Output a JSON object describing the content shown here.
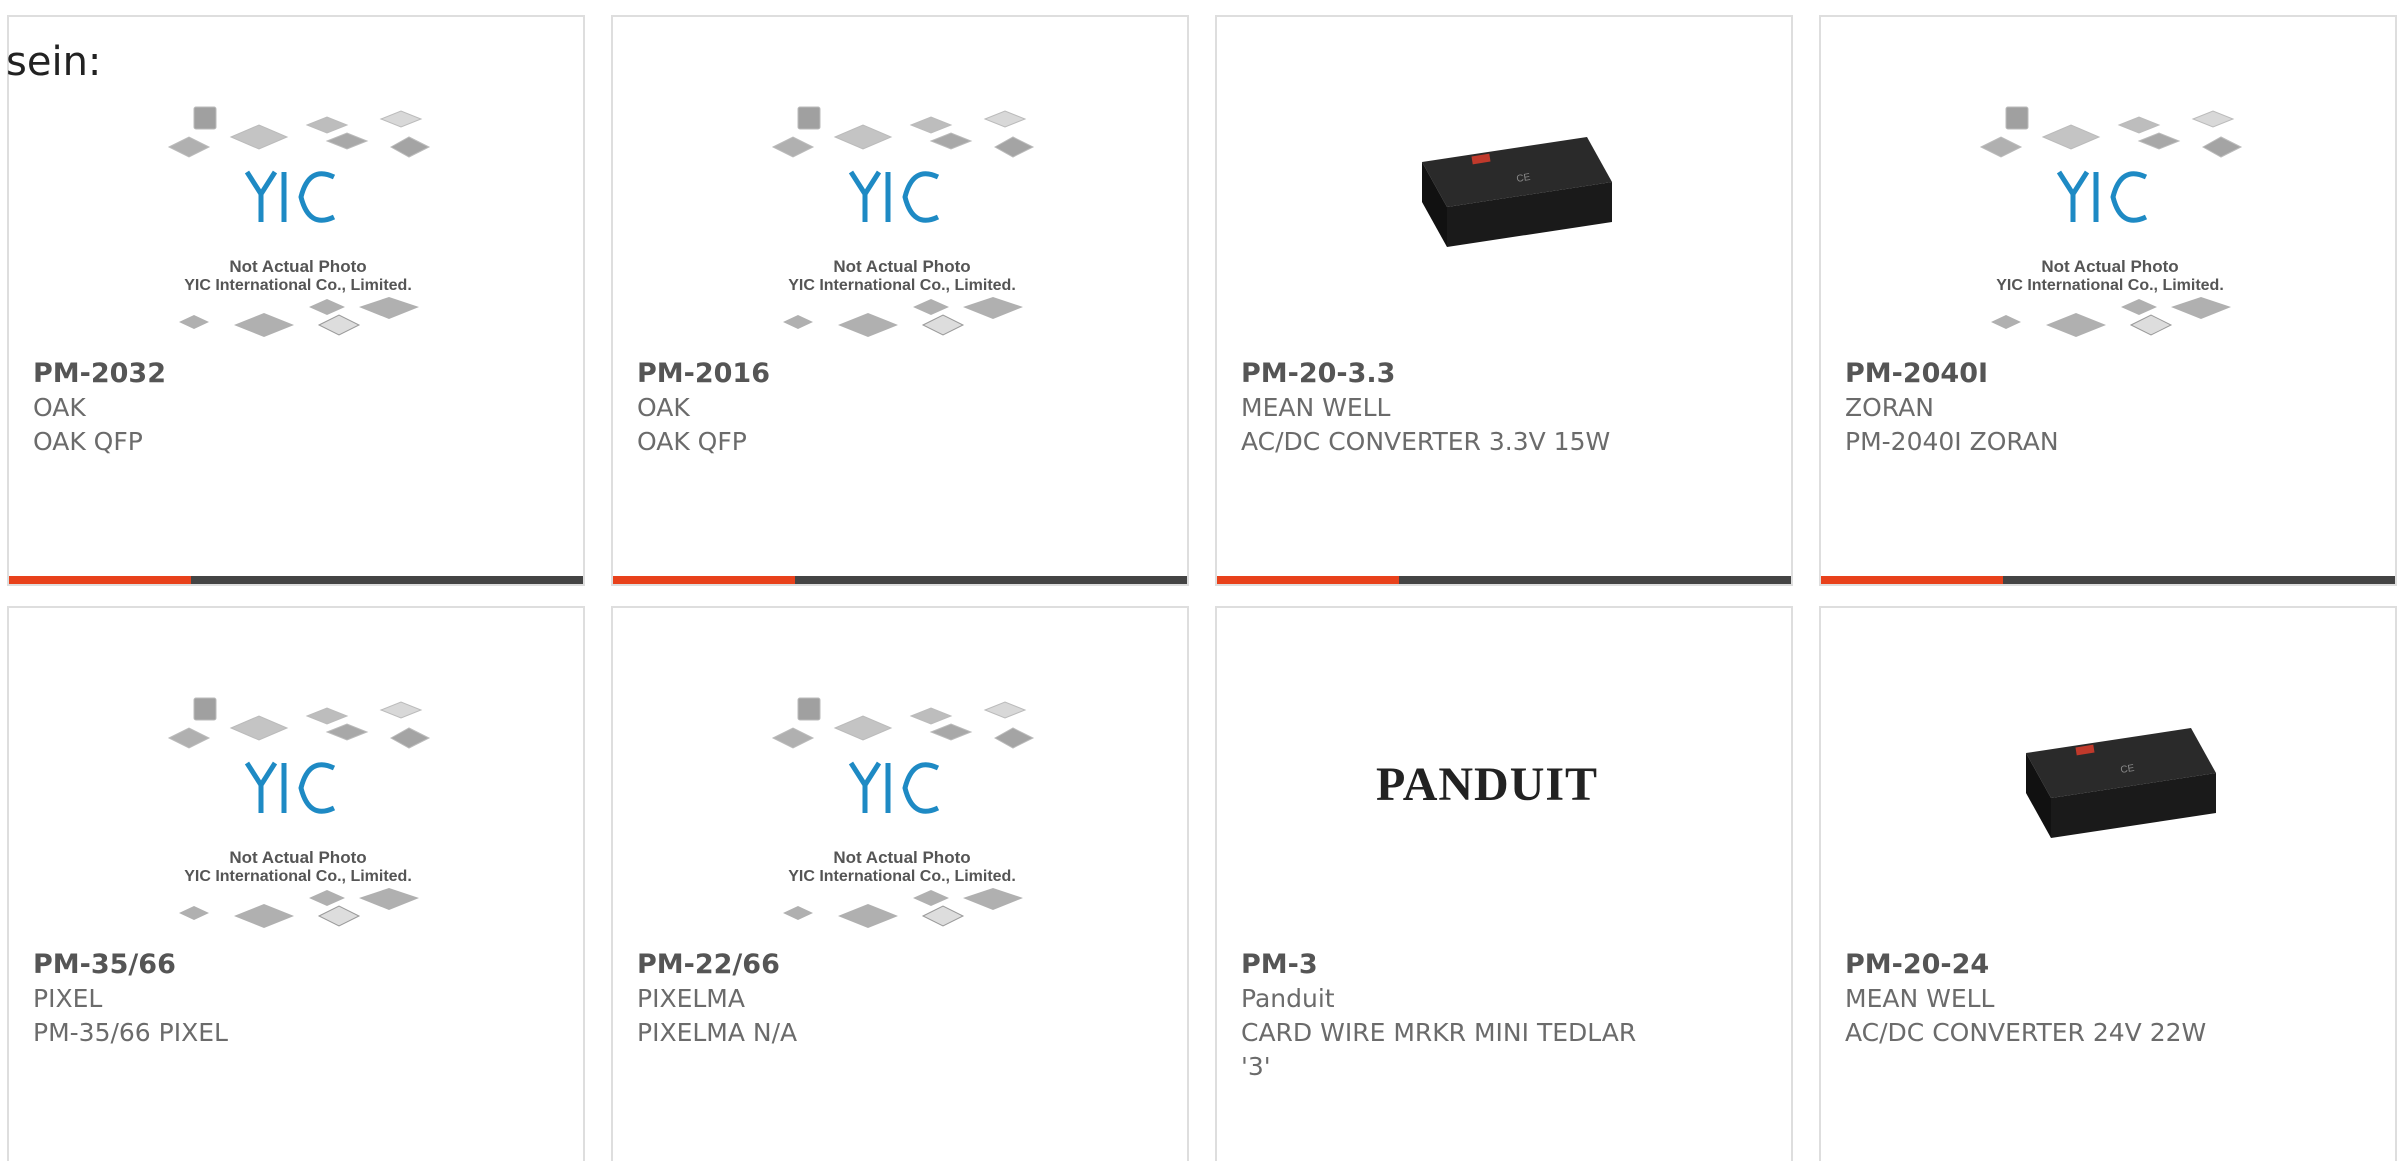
{
  "stray_text": "sein:",
  "accent_color": "#e8411b",
  "bar_color": "#444444",
  "placeholder": {
    "line1": "Not Actual Photo",
    "line2": "YIC International Co., Limited.",
    "logo": "YIC"
  },
  "panduit_logo": "PANDUIT",
  "products": [
    {
      "part": "PM-2032",
      "manufacturer": "OAK",
      "description": "OAK QFP",
      "image": "yic-placeholder"
    },
    {
      "part": "PM-2016",
      "manufacturer": "OAK",
      "description": "OAK QFP",
      "image": "yic-placeholder"
    },
    {
      "part": "PM-20-3.3",
      "manufacturer": "MEAN WELL",
      "description": "AC/DC CONVERTER 3.3V 15W",
      "image": "power-module"
    },
    {
      "part": "PM-2040I",
      "manufacturer": "ZORAN",
      "description": "PM-2040I ZORAN",
      "image": "yic-placeholder"
    },
    {
      "part": "PM-35/66",
      "manufacturer": "PIXEL",
      "description": "PM-35/66 PIXEL",
      "image": "yic-placeholder"
    },
    {
      "part": "PM-22/66",
      "manufacturer": "PIXELMA",
      "description": "PIXELMA N/A",
      "image": "yic-placeholder"
    },
    {
      "part": "PM-3",
      "manufacturer": "Panduit",
      "description": "CARD WIRE MRKR MINI TEDLAR '3'",
      "image": "panduit-logo"
    },
    {
      "part": "PM-20-24",
      "manufacturer": "MEAN WELL",
      "description": "AC/DC CONVERTER 24V 22W",
      "image": "power-module"
    }
  ]
}
